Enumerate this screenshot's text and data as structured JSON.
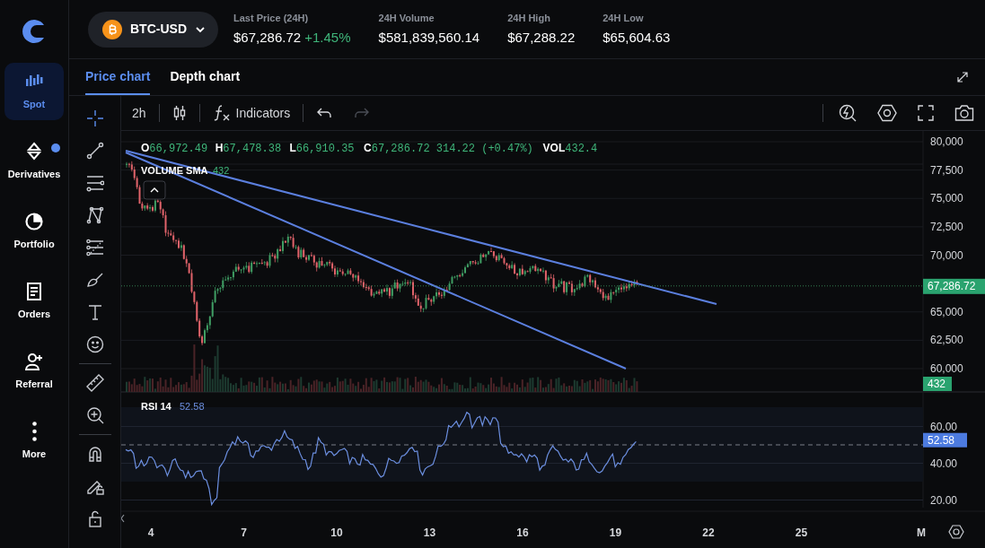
{
  "nav": {
    "items": [
      {
        "kind": "spot",
        "label": "Spot",
        "selected": true,
        "badge": false
      },
      {
        "kind": "derivatives",
        "label": "Derivatives",
        "selected": false,
        "badge": true
      },
      {
        "kind": "portfolio",
        "label": "Portfolio",
        "selected": false,
        "badge": false
      },
      {
        "kind": "orders",
        "label": "Orders",
        "selected": false,
        "badge": false
      },
      {
        "kind": "referral",
        "label": "Referral",
        "selected": false,
        "badge": false
      },
      {
        "kind": "more",
        "label": "More",
        "selected": false,
        "badge": false
      }
    ]
  },
  "header": {
    "pair": "BTC-USD",
    "stats": [
      {
        "label": "Last Price (24H)",
        "value": "$67,286.72",
        "change": "+1.45%"
      },
      {
        "label": "24H Volume",
        "value": "$581,839,560.14"
      },
      {
        "label": "24H High",
        "value": "$67,288.22"
      },
      {
        "label": "24H Low",
        "value": "$65,604.63"
      }
    ]
  },
  "tabs": [
    {
      "label": "Price chart",
      "selected": true
    },
    {
      "label": "Depth chart",
      "selected": false
    }
  ],
  "toolbar": {
    "interval": "2h",
    "indicators": "Indicators",
    "undo_disabled": false,
    "redo_disabled": true
  },
  "drawing_tools": [
    [
      {
        "kind": "crosshair",
        "selected": true
      },
      {
        "kind": "line",
        "selected": false
      },
      {
        "kind": "hlines",
        "selected": false
      },
      {
        "kind": "pattern",
        "selected": false
      },
      {
        "kind": "fib",
        "selected": false
      },
      {
        "kind": "brush",
        "selected": false
      },
      {
        "kind": "text",
        "selected": false
      },
      {
        "kind": "emoji",
        "selected": false
      }
    ],
    [
      {
        "kind": "ruler",
        "selected": false
      },
      {
        "kind": "zoom",
        "selected": false
      }
    ],
    [
      {
        "kind": "magnet",
        "selected": false
      },
      {
        "kind": "pencillock",
        "selected": false
      },
      {
        "kind": "lock",
        "selected": false
      }
    ]
  ],
  "legend": {
    "ohlc": [
      {
        "key": "O",
        "value": "66,972.49"
      },
      {
        "key": "H",
        "value": "67,478.38"
      },
      {
        "key": "L",
        "value": "66,910.35"
      },
      {
        "key": "C",
        "value": "67,286.72 314.22 (+0.47%)"
      },
      {
        "key": "VOL",
        "value": "432.4"
      }
    ],
    "volume_sma": {
      "label": "VOLUME SMA",
      "value": "432"
    }
  },
  "price_axis": {
    "ticks": [
      "80,000",
      "77,500",
      "75,000",
      "72,500",
      "70,000",
      "65,000",
      "62,500",
      "60,000"
    ],
    "last_price": "67,286.72",
    "volume_tag": "432"
  },
  "rsi": {
    "label": "RSI 14",
    "value": "52.58",
    "ticks": [
      "60.00",
      "40.00",
      "20.00"
    ],
    "tag": "52.58"
  },
  "time_axis": {
    "labels": [
      "4",
      "7",
      "10",
      "13",
      "16",
      "19",
      "22",
      "25"
    ],
    "scale_mode": "M"
  }
}
